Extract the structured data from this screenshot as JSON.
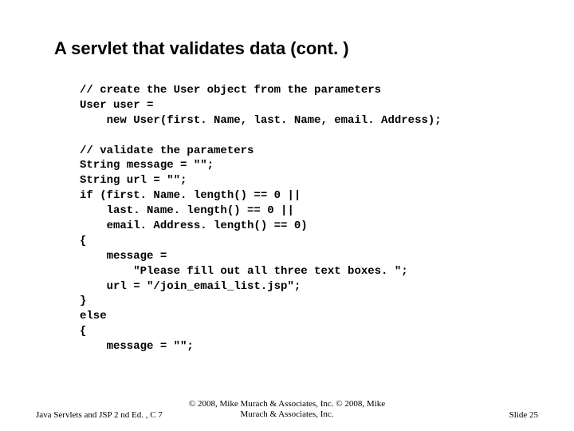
{
  "slide": {
    "title": "A servlet that validates data (cont. )",
    "code_lines": [
      "// create the User object from the parameters",
      "User user =",
      "    new User(first. Name, last. Name, email. Address);",
      "",
      "// validate the parameters",
      "String message = \"\";",
      "String url = \"\";",
      "if (first. Name. length() == 0 ||",
      "    last. Name. length() == 0 ||",
      "    email. Address. length() == 0)",
      "{",
      "    message =",
      "        \"Please fill out all three text boxes. \";",
      "    url = \"/join_email_list.jsp\";",
      "}",
      "else",
      "{",
      "    message = \"\";"
    ]
  },
  "footer": {
    "left": "Java Servlets and JSP 2 nd Ed. , C 7",
    "center_line1": "© 2008, Mike Murach & Associates, Inc. © 2008, Mike",
    "center_line2": "Murach & Associates, Inc.",
    "right": "Slide 25"
  }
}
